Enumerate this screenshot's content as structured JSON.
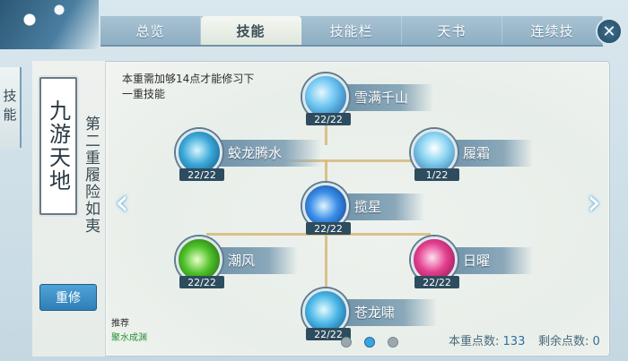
{
  "tabs": [
    {
      "label": "总览",
      "active": false
    },
    {
      "label": "技能",
      "active": true
    },
    {
      "label": "技能栏",
      "active": false
    },
    {
      "label": "天书",
      "active": false
    },
    {
      "label": "连续技",
      "active": false
    }
  ],
  "close_label": "✕",
  "side_label": "技能",
  "scroll_card_text": "九游天地",
  "stage_label": "第二重履险如夷",
  "reset_button": "重修",
  "requirement_text": "本重需加够14点才能修习下一重技能",
  "skills": [
    {
      "name": "雪满千山",
      "level": "22/22",
      "icon": "snow-mountain-icon"
    },
    {
      "name": "蛟龙腾水",
      "level": "22/22",
      "icon": "water-dragon-icon"
    },
    {
      "name": "履霜",
      "level": "1/22",
      "icon": "frost-icon"
    },
    {
      "name": "揽星",
      "level": "22/22",
      "icon": "star-crystal-icon"
    },
    {
      "name": "潮风",
      "level": "22/22",
      "icon": "wind-beetle-icon"
    },
    {
      "name": "日曜",
      "level": "22/22",
      "icon": "sun-shield-icon"
    },
    {
      "name": "苍龙啸",
      "level": "22/22",
      "icon": "azure-dragon-icon"
    }
  ],
  "recommend": {
    "label": "推荐",
    "sub": "聚水成渊"
  },
  "points": {
    "stage_label": "本重点数:",
    "stage_value": "133",
    "remain_label": "剩余点数:",
    "remain_value": "0"
  },
  "arrows": {
    "left": "‹",
    "right": "›"
  },
  "pages": {
    "count": 3,
    "current": 2
  }
}
